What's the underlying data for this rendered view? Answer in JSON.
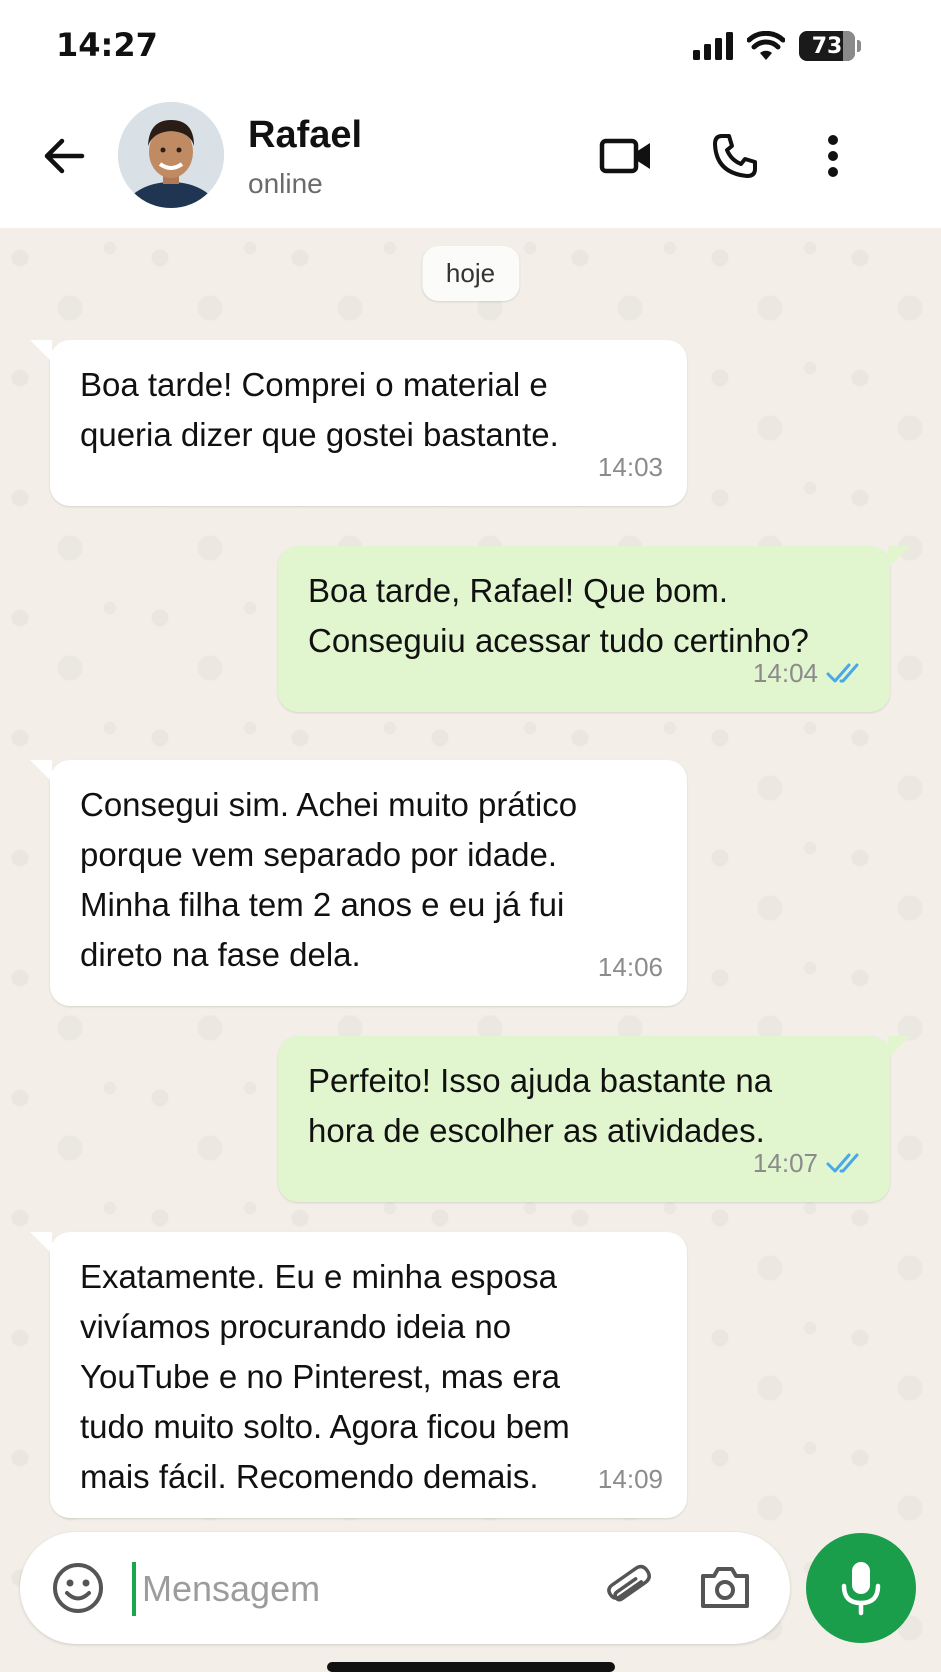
{
  "status_bar": {
    "time": "14:27",
    "battery_level": "73",
    "icons": [
      "signal-icon",
      "wifi-icon",
      "battery-icon"
    ]
  },
  "header": {
    "contact_name": "Rafael",
    "contact_status": "online",
    "icons": [
      "back-arrow-icon",
      "video-call-icon",
      "phone-call-icon",
      "more-options-icon"
    ]
  },
  "chat": {
    "date_label": "hoje",
    "messages": [
      {
        "direction": "incoming",
        "text": "Boa tarde! Comprei o material e\nqueria dizer que gostei bastante.",
        "time": "14:03"
      },
      {
        "direction": "outgoing",
        "text": "Boa tarde, Rafael! Que bom.\nConseguiu acessar tudo certinho?",
        "time": "14:04",
        "read": true
      },
      {
        "direction": "incoming",
        "text": "Consegui sim. Achei muito prático\nporque vem separado por idade.\nMinha filha tem 2 anos e eu já fui\ndireto na fase dela.",
        "time": "14:06"
      },
      {
        "direction": "outgoing",
        "text": "Perfeito! Isso ajuda bastante na\nhora de escolher as atividades.",
        "time": "14:07",
        "read": true
      },
      {
        "direction": "incoming",
        "text": "Exatamente. Eu e minha esposa\nvivíamos procurando ideia no\nYouTube e no Pinterest, mas era\ntudo muito solto. Agora ficou bem\nmais fácil. Recomendo demais.",
        "time": "14:09"
      }
    ]
  },
  "composer": {
    "placeholder": "Mensagem",
    "value": "",
    "icons": [
      "emoji-icon",
      "attach-clip-icon",
      "camera-icon",
      "microphone-icon"
    ]
  },
  "colors": {
    "outgoing_bubble": "#e1f5cf",
    "incoming_bubble": "#ffffff",
    "chat_background": "#f3efe8",
    "accent_green": "#1a9e4c",
    "read_ticks": "#4aa8e8"
  }
}
